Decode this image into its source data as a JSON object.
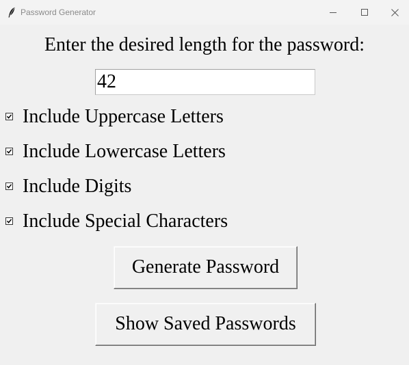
{
  "window": {
    "title": "Password Generator",
    "icon": "feather-icon",
    "controls": [
      "minimize-icon",
      "maximize-icon",
      "close-icon"
    ]
  },
  "form": {
    "prompt": "Enter the desired length for the password:",
    "length_value": "42"
  },
  "options": [
    {
      "label": "Include Uppercase Letters",
      "checked": true
    },
    {
      "label": "Include Lowercase Letters",
      "checked": true
    },
    {
      "label": "Include Digits",
      "checked": true
    },
    {
      "label": "Include Special Characters",
      "checked": true
    }
  ],
  "buttons": {
    "generate": "Generate Password",
    "show_saved": "Show Saved Passwords"
  }
}
